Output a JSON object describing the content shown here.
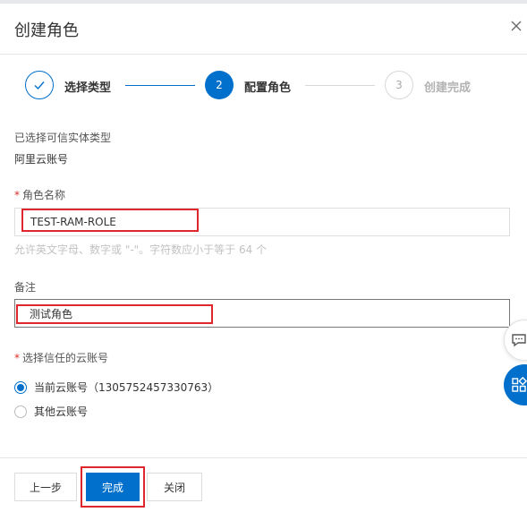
{
  "dialog": {
    "title": "创建角色",
    "close_icon": "close-icon"
  },
  "steps": [
    {
      "label": "选择类型",
      "status": "done"
    },
    {
      "number": "2",
      "label": "配置角色",
      "status": "active"
    },
    {
      "number": "3",
      "label": "创建完成",
      "status": "pending"
    }
  ],
  "entity": {
    "label": "已选择可信实体类型",
    "value": "阿里云账号"
  },
  "role_name": {
    "required_mark": "*",
    "label": "角色名称",
    "value": "TEST-RAM-ROLE",
    "hint": "允许英文字母、数字或 \"-\"。字符数应小于等于 64 个"
  },
  "remark": {
    "label": "备注",
    "value": "测试角色"
  },
  "trusted_account": {
    "required_mark": "*",
    "label": "选择信任的云账号",
    "options": [
      {
        "label": "当前云账号（1305752457330763）",
        "checked": true
      },
      {
        "label": "其他云账号",
        "checked": false
      }
    ]
  },
  "footer": {
    "prev_label": "上一步",
    "done_label": "完成",
    "close_label": "关闭"
  },
  "colors": {
    "primary": "#0070cc",
    "highlight": "#e0282c",
    "required": "#d93026"
  }
}
